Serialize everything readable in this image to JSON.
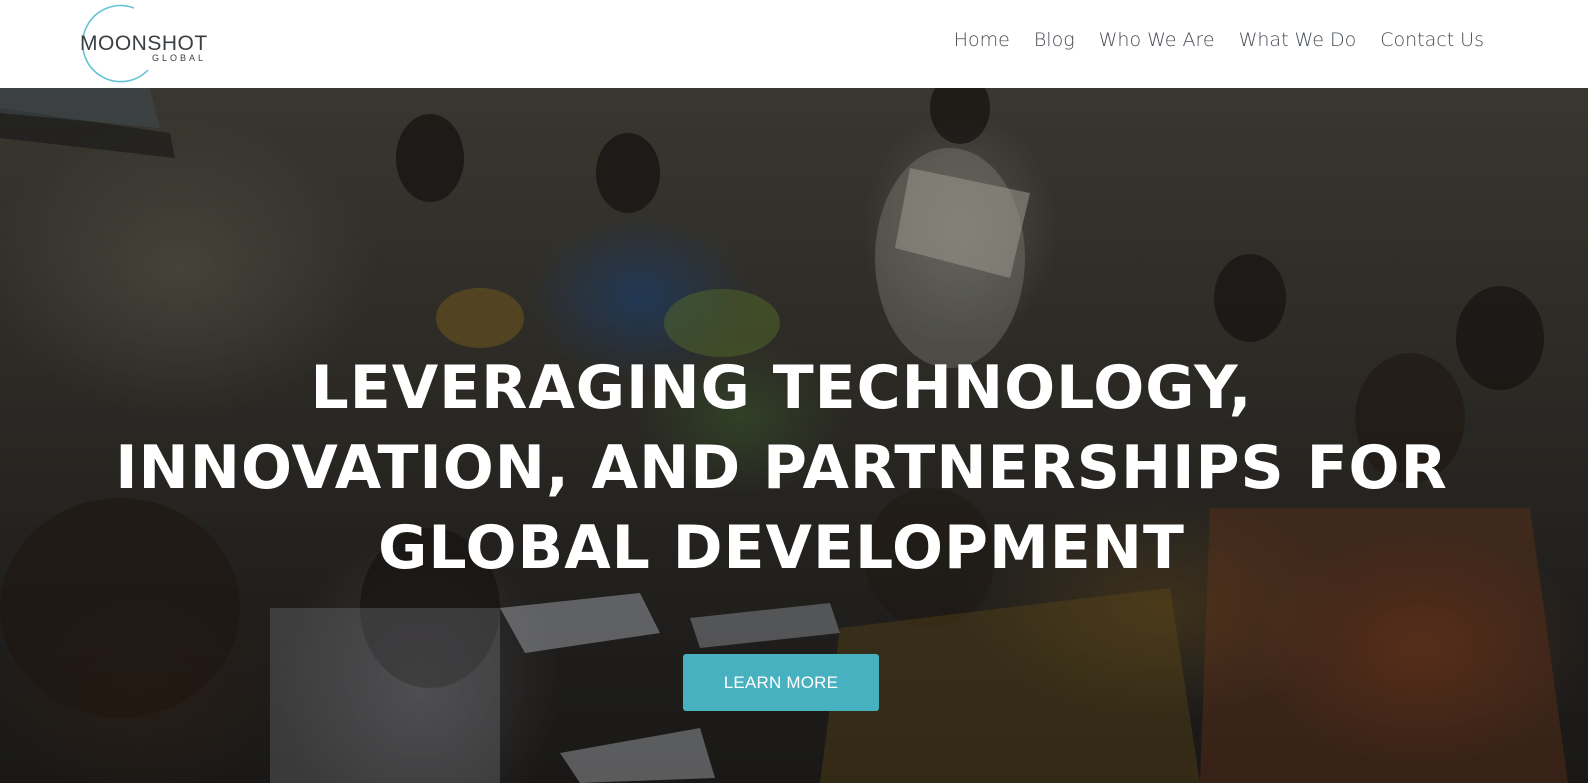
{
  "brand": {
    "name": "MOONSHOT",
    "subtitle": "GLOBAL",
    "logo_ring_color": "#63c2d6"
  },
  "nav": {
    "items": [
      {
        "label": "Home"
      },
      {
        "label": "Blog"
      },
      {
        "label": "Who We Are"
      },
      {
        "label": "What We Do"
      },
      {
        "label": "Contact Us"
      }
    ]
  },
  "hero": {
    "heading_lines": [
      "LEVERAGING TECHNOLOGY,",
      "INNOVATION, AND PARTNERSHIPS FOR",
      "GLOBAL DEVELOPMENT"
    ],
    "cta_label": "LEARN MORE",
    "cta_color": "#47b1c0"
  }
}
